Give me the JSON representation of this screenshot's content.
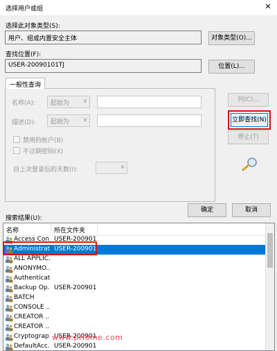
{
  "window": {
    "title": "选择用户或组",
    "close_glyph": "✕"
  },
  "object_type": {
    "label": "选择此对象类型(S):",
    "value": "用户、组或内置安全主体",
    "button": "对象类型(O)..."
  },
  "location": {
    "label": "查找位置(F):",
    "value": "USER-20090101TJ",
    "button": "位置(L)..."
  },
  "query": {
    "tab": "一般性查询",
    "name_label": "名称(A):",
    "desc_label": "描述(D):",
    "starts_with": "起始为",
    "disabled_accounts": "禁用的帐户(B)",
    "non_expiring_pw": "不过期密码(X)",
    "days_since_logon": "自上次登录后的天数(I):",
    "columns_button": "列(C)...",
    "find_now_button": "立即查找(N)",
    "stop_button": "停止(T)",
    "search_icon": "magnifier-icon"
  },
  "actions": {
    "ok": "确定",
    "cancel": "取消"
  },
  "results": {
    "label": "搜索结果(U):",
    "columns": [
      "名称",
      "所在文件夹"
    ],
    "rows": [
      {
        "name": "Access Con...",
        "folder": "USER-200901..."
      },
      {
        "name": "Administrat...",
        "folder": "USER-200901...",
        "selected": true
      },
      {
        "name": "ALL APPLIC...",
        "folder": ""
      },
      {
        "name": "ANONYMO...",
        "folder": ""
      },
      {
        "name": "Authenticat...",
        "folder": ""
      },
      {
        "name": "Backup Op...",
        "folder": "USER-200901..."
      },
      {
        "name": "BATCH",
        "folder": ""
      },
      {
        "name": "CONSOLE ...",
        "folder": ""
      },
      {
        "name": "CREATOR ...",
        "folder": ""
      },
      {
        "name": "CREATOR ...",
        "folder": ""
      },
      {
        "name": "Cryptograp...",
        "folder": "USER-200901..."
      },
      {
        "name": "DefaultAcc...",
        "folder": "USER-200901..."
      }
    ]
  },
  "watermark": "www.pHome.com"
}
